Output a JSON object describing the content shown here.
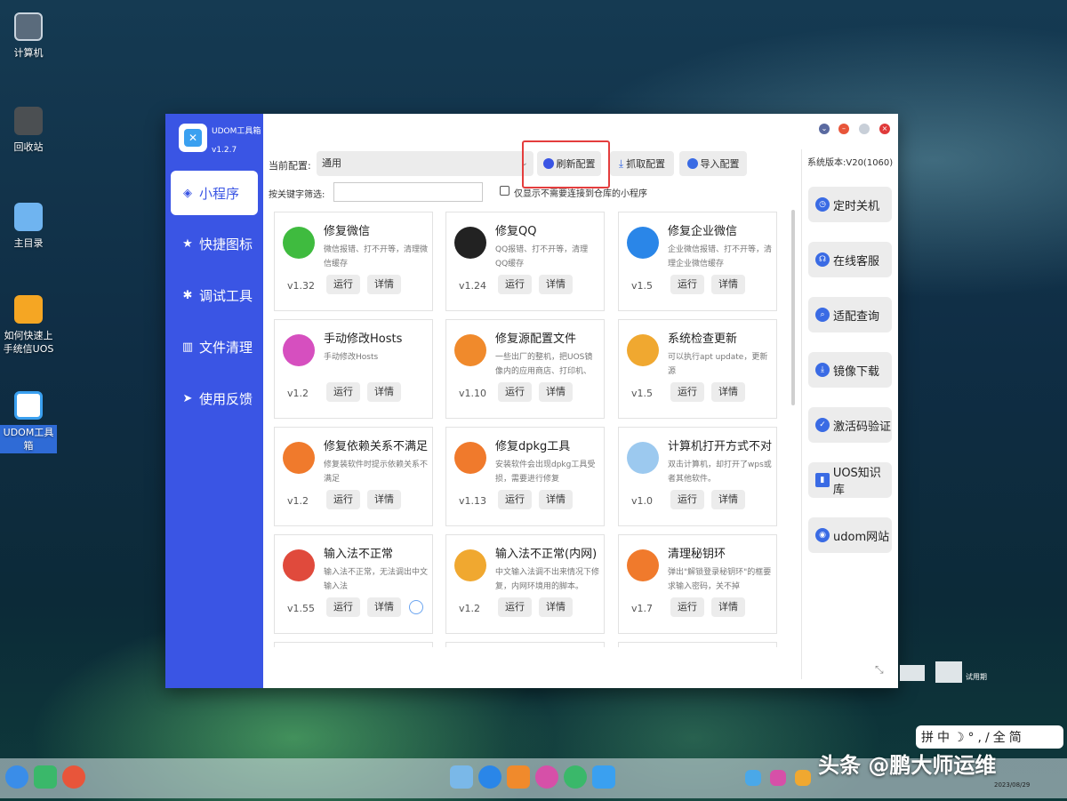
{
  "desktop": {
    "icons": [
      {
        "label": "计算机"
      },
      {
        "label": "回收站"
      },
      {
        "label": "主目录"
      },
      {
        "label": "如何快速上手统信UOS"
      },
      {
        "label": "UDOM工具箱"
      }
    ]
  },
  "window": {
    "app_title": "UDOM工具箱",
    "app_version": "v1.2.7",
    "nav": [
      {
        "label": "小程序",
        "icon": "cube-icon"
      },
      {
        "label": "快捷图标",
        "icon": "star-icon"
      },
      {
        "label": "调试工具",
        "icon": "bug-icon"
      },
      {
        "label": "文件清理",
        "icon": "trash-icon"
      },
      {
        "label": "使用反馈",
        "icon": "send-icon"
      }
    ],
    "toolbar": {
      "config_label": "当前配置:",
      "config_value": "通用",
      "refresh_label": "刷新配置",
      "fetch_label": "抓取配置",
      "import_label": "导入配置",
      "filter_label": "按关键字筛选:",
      "filter_value": "",
      "checkbox_label": "仅显示不需要连接到仓库的小程序"
    },
    "run_label": "运行",
    "detail_label": "详情",
    "cards": [
      {
        "title": "修复微信",
        "desc": "微信报错、打不开等，清理微信缓存",
        "version": "v1.32",
        "color": "#3fbb3f"
      },
      {
        "title": "修复QQ",
        "desc": "QQ报错、打不开等，清理QQ缓存",
        "version": "v1.24",
        "color": "#222222"
      },
      {
        "title": "修复企业微信",
        "desc": "企业微信报错、打不开等，清理企业微信缓存",
        "version": "v1.5",
        "color": "#2a86e8"
      },
      {
        "title": "手动修改Hosts",
        "desc": "手动修改Hosts",
        "version": "v1.2",
        "color": "#d64fbf"
      },
      {
        "title": "修复源配置文件",
        "desc": "一些出厂的整机，把UOS镜像内的应用商店、打印机、",
        "version": "v1.10",
        "color": "#f08a2c"
      },
      {
        "title": "系统检查更新",
        "desc": "可以执行apt update，更新源",
        "version": "v1.5",
        "color": "#f0a830"
      },
      {
        "title": "修复依赖关系不满足",
        "desc": "修复装软件时提示依赖关系不满足",
        "version": "v1.2",
        "color": "#f07a2c"
      },
      {
        "title": "修复dpkg工具",
        "desc": "安装软件会出现dpkg工具受损，需要进行修复",
        "version": "v1.13",
        "color": "#f07a2c"
      },
      {
        "title": "计算机打开方式不对",
        "desc": "双击计算机，却打开了wps或者其他软件。",
        "version": "v1.0",
        "color": "#9cc9ef"
      },
      {
        "title": "输入法不正常",
        "desc": "输入法不正常，无法调出中文输入法",
        "version": "v1.55",
        "color": "#e04a3c"
      },
      {
        "title": "输入法不正常(内网)",
        "desc": "中文输入法调不出来情况下修复，内网环境用的脚本。",
        "version": "v1.2",
        "color": "#f0a830"
      },
      {
        "title": "清理秘钥环",
        "desc": "弹出\"解锁登录秘钥环\"的框要求输入密码，关不掉",
        "version": "v1.7",
        "color": "#f07a2c"
      }
    ],
    "right_panel": {
      "system_version": "系统版本:V20(1060)",
      "buttons": [
        {
          "label": "定时关机",
          "color": "#3a6be4"
        },
        {
          "label": "在线客服",
          "color": "#3a6be4"
        },
        {
          "label": "适配查询",
          "color": "#3a6be4"
        },
        {
          "label": "镜像下载",
          "color": "#3a6be4"
        },
        {
          "label": "激活码验证",
          "color": "#3a6be4"
        },
        {
          "label": "UOS知识库",
          "color": "#3a6be4"
        },
        {
          "label": "udom网站",
          "color": "#3a6be4"
        }
      ]
    }
  },
  "overlay": {
    "ime_text": "拼中☽°,∕全简",
    "watermark": "头条 @鹏大师运维",
    "trial": "试用期",
    "date": "2023/08/29"
  }
}
